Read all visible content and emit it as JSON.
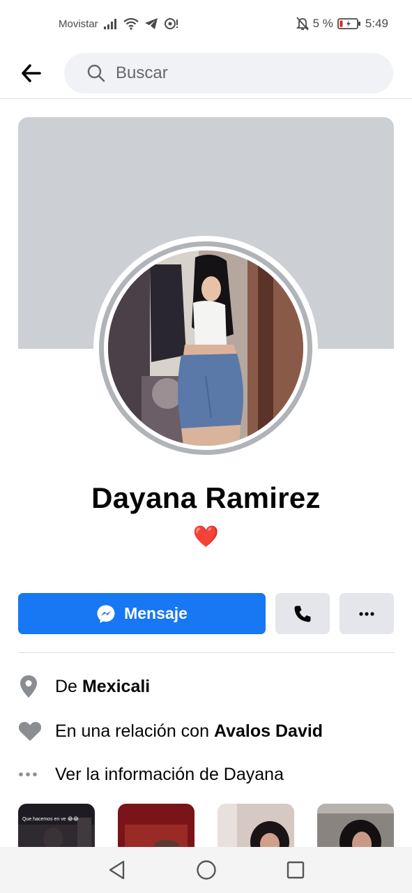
{
  "status_bar": {
    "carrier": "Movistar",
    "battery_percent": "5 %",
    "time": "5:49",
    "icons": [
      "signal-icon",
      "wifi-icon",
      "telegram-icon",
      "hotspot-icon",
      "muted-bell-icon",
      "battery-icon"
    ]
  },
  "top_bar": {
    "back_icon": "arrow-left-icon",
    "search_icon": "search-icon",
    "search_placeholder": "Buscar"
  },
  "profile": {
    "name": "Dayana Ramirez",
    "bio": "❤️"
  },
  "actions": {
    "message_label": "Mensaje",
    "message_icon": "messenger-icon",
    "call_icon": "phone-icon",
    "more_icon": "more-dots-icon"
  },
  "info": [
    {
      "icon": "location-pin-icon",
      "prefix": "De",
      "bold": "Mexicali"
    },
    {
      "icon": "heart-icon",
      "prefix": "En una relación con",
      "bold": "Avalos David"
    },
    {
      "icon": "dots-icon",
      "prefix": "Ver la información de Dayana",
      "bold": ""
    }
  ],
  "photo_caption": "Que hacemos en ve 😂😂",
  "nav": {
    "icons": [
      "back-triangle-icon",
      "home-circle-icon",
      "recents-square-icon"
    ]
  },
  "colors": {
    "accent": "#1877f2",
    "secondary_button": "#e4e6eb",
    "cover": "#ccd0d5",
    "avatar_ring": "#b0b3b8",
    "search_bg": "#f0f2f5",
    "heart": "#e41e3f"
  }
}
